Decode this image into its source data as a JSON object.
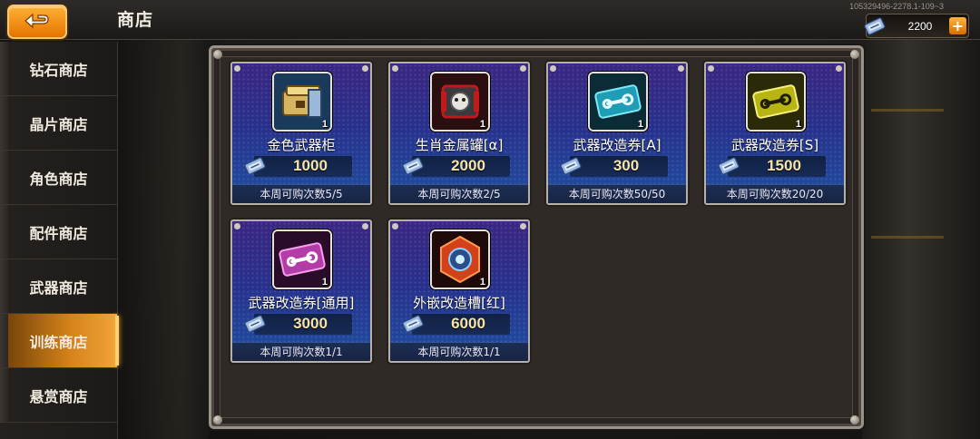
{
  "header": {
    "title": "商店",
    "version": "105329496-2278.1-109~3",
    "currency": {
      "value": "2200",
      "plus": "+"
    }
  },
  "sidebar": {
    "items": [
      {
        "label": "钻石商店",
        "active": false
      },
      {
        "label": "晶片商店",
        "active": false
      },
      {
        "label": "角色商店",
        "active": false
      },
      {
        "label": "配件商店",
        "active": false
      },
      {
        "label": "武器商店",
        "active": false
      },
      {
        "label": "训练商店",
        "active": true
      },
      {
        "label": "悬赏商店",
        "active": false
      }
    ]
  },
  "shop": {
    "items": [
      {
        "name": "金色武器柜",
        "qty": "1",
        "price": "1000",
        "limit": "本周可购次数5/5",
        "icon": "gold-weapon-cabinet-icon"
      },
      {
        "name": "生肖金属罐[α]",
        "qty": "1",
        "price": "2000",
        "limit": "本周可购次数2/5",
        "icon": "zodiac-metal-can-icon"
      },
      {
        "name": "武器改造券[A]",
        "qty": "1",
        "price": "300",
        "limit": "本周可购次数50/50",
        "icon": "weapon-modify-ticket-a-icon"
      },
      {
        "name": "武器改造券[S]",
        "qty": "1",
        "price": "1500",
        "limit": "本周可购次数20/20",
        "icon": "weapon-modify-ticket-s-icon"
      },
      {
        "name": "武器改造券[通用]",
        "qty": "1",
        "price": "3000",
        "limit": "本周可购次数1/1",
        "icon": "weapon-modify-ticket-universal-icon"
      },
      {
        "name": "外嵌改造槽[红]",
        "qty": "1",
        "price": "6000",
        "limit": "本周可购次数1/1",
        "icon": "inlay-slot-red-icon"
      }
    ]
  },
  "colors": {
    "accent": "#f08a10",
    "card_top": "#3c2680",
    "card_bottom": "#1f4fa0",
    "price_text": "#f6e3a8"
  }
}
